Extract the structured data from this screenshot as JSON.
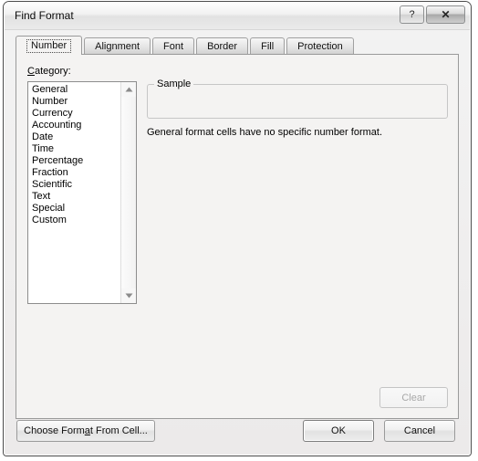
{
  "window": {
    "title": "Find Format",
    "help_button": "?",
    "close_button": "✕"
  },
  "tabs": [
    {
      "label": "Number",
      "active": true
    },
    {
      "label": "Alignment",
      "active": false
    },
    {
      "label": "Font",
      "active": false
    },
    {
      "label": "Border",
      "active": false
    },
    {
      "label": "Fill",
      "active": false
    },
    {
      "label": "Protection",
      "active": false
    }
  ],
  "number_tab": {
    "category_label": "Category:",
    "category_accel": "C",
    "categories": [
      "General",
      "Number",
      "Currency",
      "Accounting",
      "Date",
      "Time",
      "Percentage",
      "Fraction",
      "Scientific",
      "Text",
      "Special",
      "Custom"
    ],
    "sample": {
      "group_title": "Sample",
      "value": "",
      "description": "General format cells have no specific number format."
    },
    "clear_button": "Clear"
  },
  "footer": {
    "choose_format_label": "Choose Format From Cell...",
    "choose_format_accel": "a",
    "ok_label": "OK",
    "cancel_label": "Cancel"
  },
  "colors": {
    "dialog_background": "#f0f0f0",
    "panel_background": "#f4f3f2",
    "listbox_background": "#ffffff",
    "border": "#9a9a9a",
    "text": "#000000",
    "disabled_text": "#a8a8a8"
  }
}
